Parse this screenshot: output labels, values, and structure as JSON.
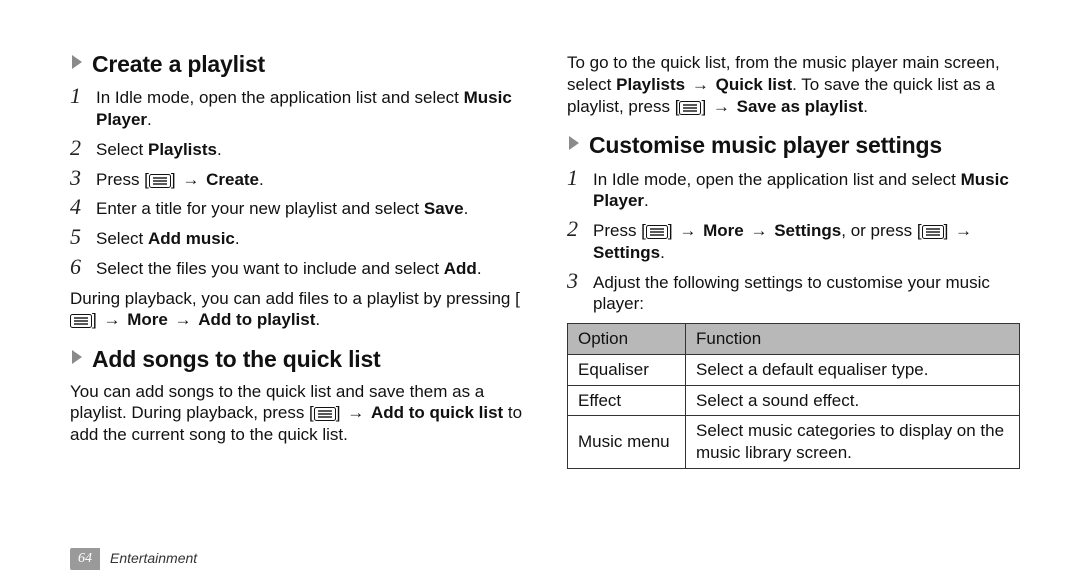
{
  "glyphs": {
    "arrow": "→"
  },
  "left": {
    "create": {
      "title": "Create a playlist",
      "steps": [
        {
          "n": "1",
          "pre": "In Idle mode, open the application list and select ",
          "bold": "Music Player",
          "post": "."
        },
        {
          "n": "2",
          "pre": "Select ",
          "bold": "Playlists",
          "post": "."
        },
        {
          "n": "3",
          "type": "press_create"
        },
        {
          "n": "4",
          "pre": "Enter a title for your new playlist and select ",
          "bold": "Save",
          "post": "."
        },
        {
          "n": "5",
          "pre": "Select ",
          "bold": "Add music",
          "post": "."
        },
        {
          "n": "6",
          "pre": "Select the files you want to include and select ",
          "bold": "Add",
          "post": "."
        }
      ],
      "tail_type": "during_playback_add"
    },
    "quicklist": {
      "title": "Add songs to the quick list",
      "body_type": "quicklist_body"
    }
  },
  "right": {
    "intro_type": "quicklist_intro",
    "customise": {
      "title": "Customise music player settings",
      "steps": [
        {
          "n": "1",
          "pre": "In Idle mode, open the application list and select ",
          "bold": "Music Player",
          "post": "."
        },
        {
          "n": "2",
          "type": "press_more_settings"
        },
        {
          "n": "3",
          "pre": "Adjust the following settings to customise your music player:",
          "bold": "",
          "post": ""
        }
      ],
      "table": {
        "headers": [
          "Option",
          "Function"
        ],
        "rows": [
          [
            "Equaliser",
            "Select a default equaliser type."
          ],
          [
            "Effect",
            "Select a sound effect."
          ],
          [
            "Music menu",
            "Select music categories to display on the music library screen."
          ]
        ]
      }
    }
  },
  "footer": {
    "page": "64",
    "section": "Entertainment"
  }
}
